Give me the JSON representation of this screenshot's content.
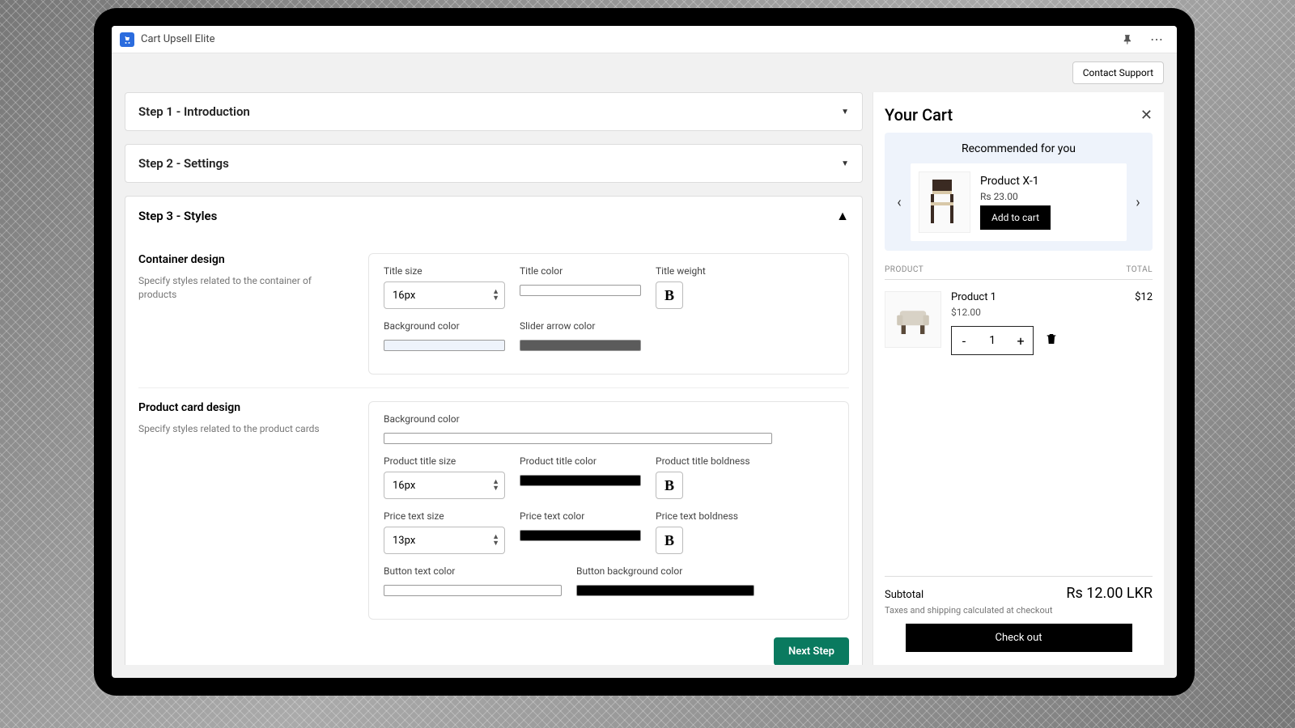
{
  "app": {
    "title": "Cart Upsell Elite"
  },
  "header": {
    "contact_support": "Contact Support"
  },
  "steps": {
    "s1": "Step 1 - Introduction",
    "s2": "Step 2 - Settings",
    "s3": "Step 3 - Styles"
  },
  "container_design": {
    "title": "Container design",
    "desc": "Specify styles related to the container of products",
    "fields": {
      "title_size_label": "Title size",
      "title_size_value": "16px",
      "title_color_label": "Title color",
      "title_color_value": "#000000",
      "title_weight_label": "Title weight",
      "bg_label": "Background color",
      "bg_value": "#eef3fb",
      "arrow_label": "Slider arrow color",
      "arrow_value": "#5b5b5b"
    }
  },
  "product_card": {
    "title": "Product card design",
    "desc": "Specify styles related to the product cards",
    "fields": {
      "bg_label": "Background color",
      "bg_value": "#ffffff",
      "ptitle_size_label": "Product title size",
      "ptitle_size_value": "16px",
      "ptitle_color_label": "Product title color",
      "ptitle_color_value": "#000000",
      "ptitle_bold_label": "Product title boldness",
      "price_size_label": "Price text size",
      "price_size_value": "13px",
      "price_color_label": "Price text color",
      "price_color_value": "#000000",
      "price_bold_label": "Price text boldness",
      "btn_text_color_label": "Button text color",
      "btn_text_color_value": "#ffffff",
      "btn_bg_label": "Button background color",
      "btn_bg_value": "#000000"
    }
  },
  "next_step": "Next Step",
  "cart": {
    "title": "Your Cart",
    "reco_title": "Recommended for you",
    "reco_item": {
      "name": "Product X-1",
      "price": "Rs 23.00",
      "add": "Add to cart"
    },
    "columns": {
      "product": "PRODUCT",
      "total": "TOTAL"
    },
    "line": {
      "name": "Product 1",
      "price": "$12.00",
      "qty": "1",
      "total": "$12"
    },
    "subtotal_label": "Subtotal",
    "subtotal_value": "Rs 12.00 LKR",
    "tax_note": "Taxes and shipping calculated at checkout",
    "checkout": "Check out"
  }
}
